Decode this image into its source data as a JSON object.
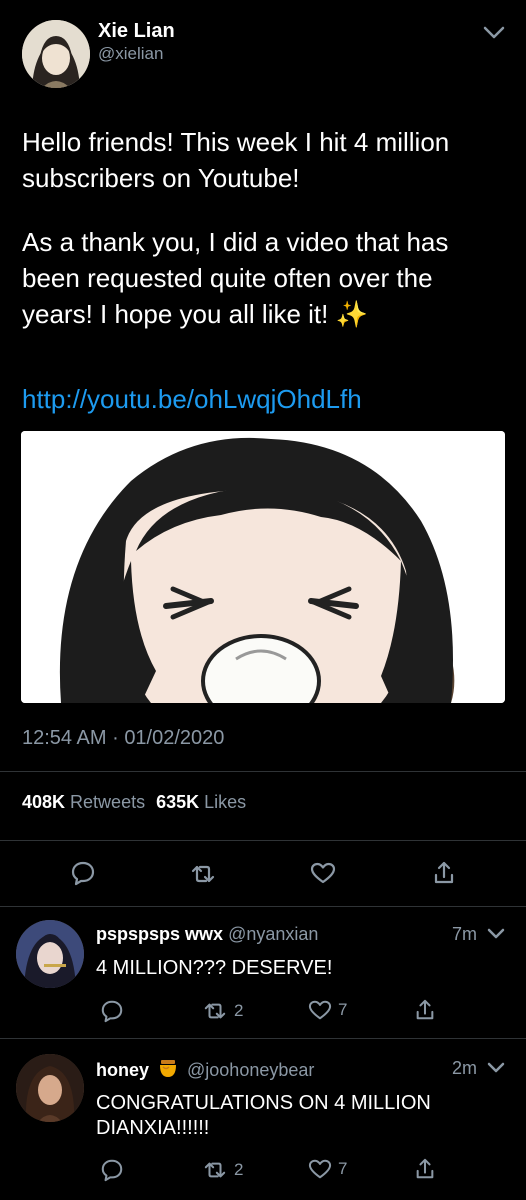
{
  "tweet": {
    "author": {
      "name": "Xie Lian",
      "handle": "@xielian"
    },
    "text_line1": "Hello friends! This week I hit 4 million",
    "text_line2": "subscribers on Youtube!",
    "text_line3": "As a thank you, I did a video that has",
    "text_line4": "been requested quite often over the",
    "text_line5": "years! I hope you all like it! ✨",
    "link": "http://youtu.be/ohLwqjOhdLfh",
    "time": "12:54 AM",
    "separator": "·",
    "date": "01/02/2020",
    "retweets_count": "408K",
    "retweets_label": "Retweets",
    "likes_count": "635K",
    "likes_label": "Likes"
  },
  "replies": [
    {
      "name": "pspspsps wwx",
      "handle": "@nyanxian",
      "time": "7m",
      "text": "4 MILLION??? DESERVE!",
      "retweets": "2",
      "likes": "7"
    },
    {
      "name": "honey",
      "badge_icon": "honey-pot-emoji",
      "handle": "@joohoneybear",
      "time": "2m",
      "text_line1": "CONGRATULATIONS ON 4 MILLION",
      "text_line2": "DIANXIA!!!!!!",
      "retweets": "2",
      "likes": "7"
    }
  ],
  "colors": {
    "background": "#000000",
    "text": "#ffffff",
    "muted": "#8b98a5",
    "link": "#1d9bf0",
    "divider": "#2f3336"
  }
}
